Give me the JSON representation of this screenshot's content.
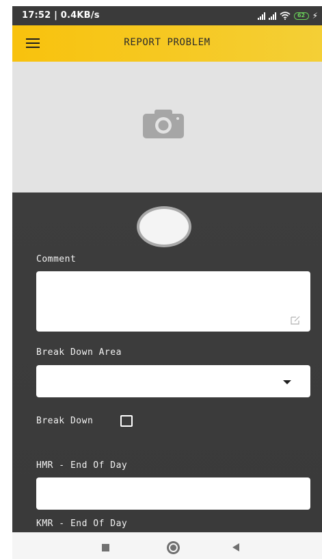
{
  "status_bar": {
    "time": "17:52 | 0.4KB/s",
    "battery": "62"
  },
  "header": {
    "title": "REPORT PROBLEM"
  },
  "form": {
    "comment_label": "Comment",
    "comment_value": "",
    "break_down_area_label": "Break Down Area",
    "break_down_area_value": "",
    "break_down_label": "Break Down",
    "break_down_checked": false,
    "hmr_label": "HMR - End Of Day",
    "hmr_value": "",
    "kmr_label": "KMR - End Of Day"
  },
  "icons": {
    "menu": "menu-icon",
    "camera": "camera-icon",
    "edit": "edit-icon",
    "dropdown": "chevron-down-icon",
    "nav_recent": "square-icon",
    "nav_home": "circle-icon",
    "nav_back": "back-triangle-icon"
  },
  "colors": {
    "header_bg": "#f5c518",
    "form_bg": "#3c3c3c",
    "photo_bg": "#e3e3e3",
    "battery": "#6ad15a"
  }
}
